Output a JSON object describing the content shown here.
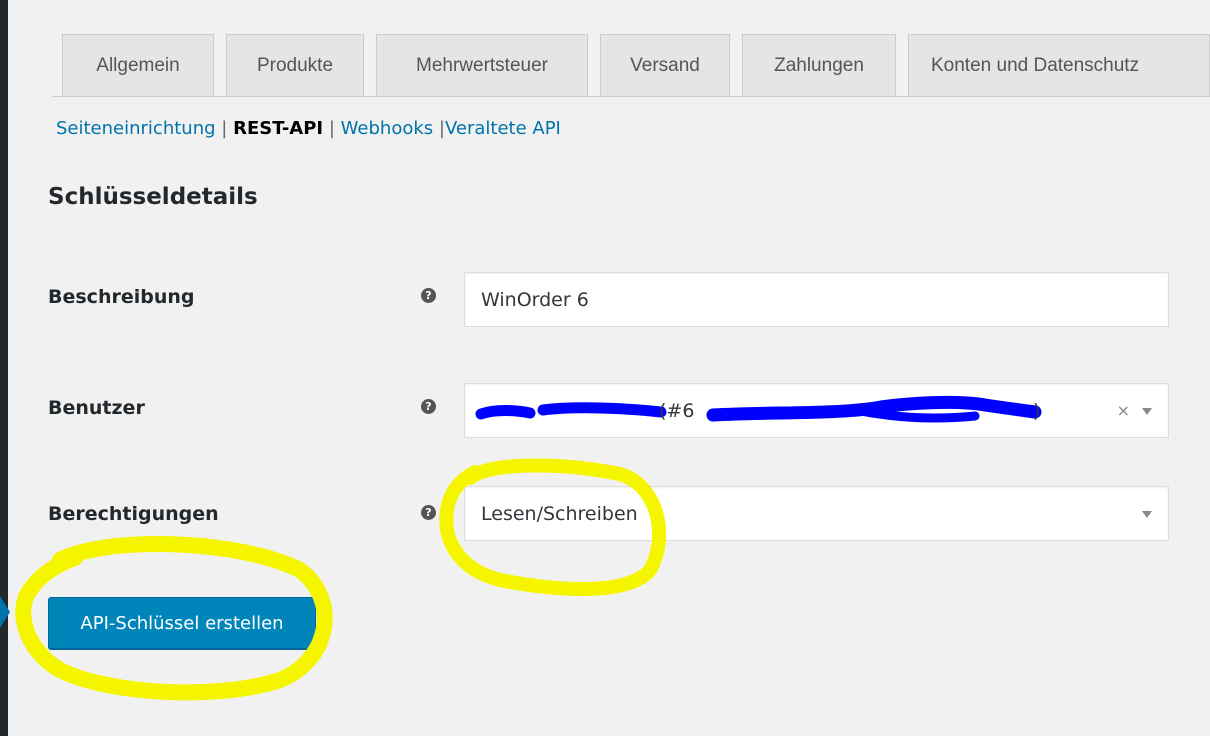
{
  "tabs": [
    {
      "label": "Allgemein"
    },
    {
      "label": "Produkte"
    },
    {
      "label": "Mehrwertsteuer"
    },
    {
      "label": "Versand"
    },
    {
      "label": "Zahlungen"
    },
    {
      "label": "Konten und Datenschutz"
    }
  ],
  "subnav": {
    "items": [
      {
        "label": "Seiteneinrichtung",
        "current": false
      },
      {
        "label": "REST-API",
        "current": true
      },
      {
        "label": "Webhooks",
        "current": false
      },
      {
        "label": "Veraltete API",
        "current": false
      }
    ],
    "separator": "|"
  },
  "section_title": "Schlüsseldetails",
  "form": {
    "description": {
      "label": "Beschreibung",
      "value": "WinOrder 6",
      "help": "?"
    },
    "user": {
      "label": "Benutzer",
      "value_visible": "(#6",
      "clear": "×",
      "help": "?"
    },
    "permissions": {
      "label": "Berechtigungen",
      "value": "Lesen/Schreiben",
      "help": "?"
    }
  },
  "actions": {
    "create_button": "API-Schlüssel erstellen"
  },
  "colors": {
    "accent": "#0085ba",
    "link": "#0073aa",
    "highlight": "#f5f500",
    "redaction": "#0000ff"
  }
}
